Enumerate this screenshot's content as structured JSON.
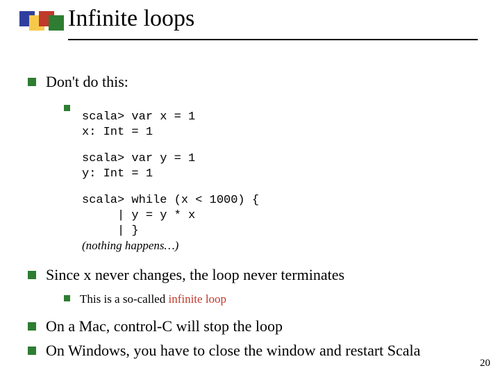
{
  "title": "Infinite loops",
  "bullets": {
    "b1": "Don't do this:",
    "b2": "Since x never changes, the loop never terminates",
    "b2sub_pre": "This is a so-called ",
    "b2sub_red": "infinite loop",
    "b3": "On a Mac, control-C will stop the loop",
    "b4": "On Windows, you have to close the window and restart Scala"
  },
  "code": {
    "block1": "scala> var x = 1\nx: Int = 1",
    "block2": "scala> var y = 1\ny: Int = 1",
    "block3": "scala> while (x < 1000) {\n     | y = y * x\n     | }",
    "nothing": "(nothing happens…)"
  },
  "page_number": "20"
}
